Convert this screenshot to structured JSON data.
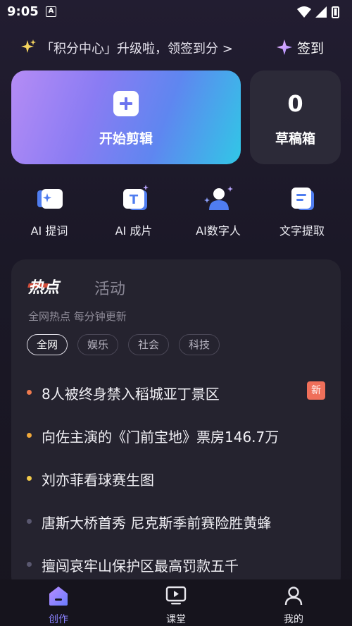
{
  "status_bar": {
    "time": "9:05",
    "notification_letter": "A"
  },
  "promo": {
    "text": "「积分中心」升级啦，领签到分 >",
    "checkin_label": "签到"
  },
  "create_card": {
    "label": "开始剪辑"
  },
  "draft_card": {
    "count": "0",
    "label": "草稿箱"
  },
  "tools": [
    {
      "label": "AI 提词",
      "icon": "ai-prompt-icon"
    },
    {
      "label": "AI 成片",
      "icon": "ai-video-icon"
    },
    {
      "label": "AI数字人",
      "icon": "ai-avatar-icon"
    },
    {
      "label": "文字提取",
      "icon": "text-extract-icon"
    }
  ],
  "hot": {
    "tab_hot": "热点",
    "tab_activity": "活动",
    "subtitle": "全网热点 每分钟更新",
    "chips": [
      "全网",
      "娱乐",
      "社会",
      "科技"
    ],
    "active_chip": "全网",
    "items": [
      {
        "text": "8人被终身禁入稻城亚丁景区",
        "badge": "新",
        "dot_color": "#ef7a4e"
      },
      {
        "text": "向佐主演的《门前宝地》票房146.7万",
        "badge": "",
        "dot_color": "#f0a83a"
      },
      {
        "text": "刘亦菲看球赛生图",
        "badge": "",
        "dot_color": "#f1c94a"
      },
      {
        "text": "唐斯大桥首秀 尼克斯季前赛险胜黄蜂",
        "badge": "",
        "dot_color": "#5a5870"
      },
      {
        "text": "擅闯哀牢山保护区最高罚款五千",
        "badge": "",
        "dot_color": "#5a5870"
      }
    ]
  },
  "bottom_nav": [
    {
      "label": "创作",
      "icon": "create-icon",
      "active": true
    },
    {
      "label": "课堂",
      "icon": "classroom-icon",
      "active": false
    },
    {
      "label": "我的",
      "icon": "profile-icon",
      "active": false
    }
  ],
  "colors": {
    "accent": "#8b82ff",
    "badge": "#ef6f5a"
  }
}
